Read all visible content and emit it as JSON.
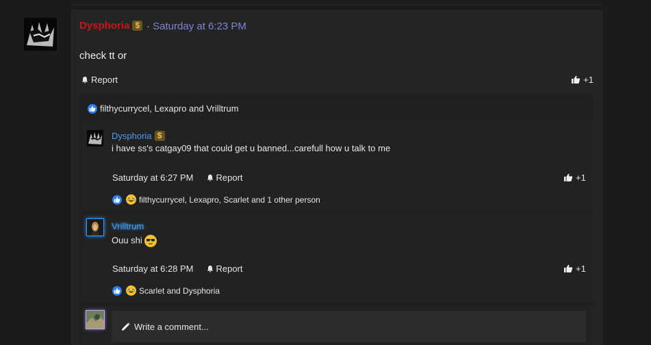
{
  "post": {
    "username": "Dysphoria",
    "separator": "·",
    "timestamp": "Saturday at 6:23 PM",
    "body": "check tt or",
    "report_label": "Report",
    "plus_label": "+1",
    "reactions_text": "filthycurrycel, Lexapro and Vrilltrum"
  },
  "comments": [
    {
      "username": "Dysphoria",
      "text": "i have ss's catgay09 that could get u banned...carefull how u talk to me",
      "timestamp": "Saturday at 6:27 PM",
      "report_label": "Report",
      "plus_label": "+1",
      "reactions_text": "filthycurrycel, Lexapro, Scarlet and 1 other person"
    },
    {
      "username": "Vrilltrum",
      "text": "Ouu shi",
      "timestamp": "Saturday at 6:28 PM",
      "report_label": "Report",
      "plus_label": "+1",
      "reactions_text": "Scarlet and Dysphoria"
    }
  ],
  "composer": {
    "placeholder": "Write a comment..."
  },
  "colors": {
    "username_red": "#c91515",
    "timestamp_link": "#7b86d6",
    "comment_username": "#4a9ef2",
    "like_blue": "#2d7ef0",
    "laugh_yellow": "#f6c234"
  },
  "icons": {
    "report": "bell-icon",
    "like": "thumbs-up-icon",
    "dollar": "dollar-badge-icon",
    "laugh": "laugh-emoji-icon",
    "pencil": "pencil-icon",
    "sunglasses": "sunglasses-emoji-icon"
  }
}
